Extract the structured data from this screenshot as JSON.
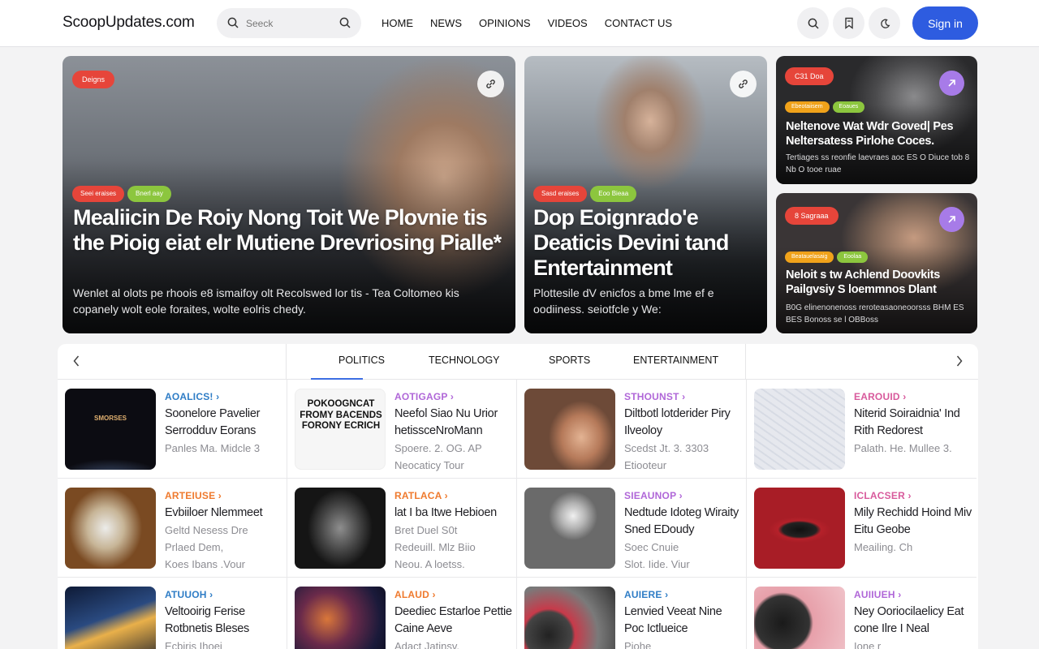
{
  "header": {
    "logo": "ScoopUpdates.com",
    "search_placeholder": "Seeck",
    "nav": [
      "HOME",
      "NEWS",
      "OPINIONS",
      "VIDEOS",
      "CONTACT US"
    ],
    "signin": "Sign in",
    "icons": [
      "search-icon",
      "bookmark-icon",
      "moon-icon"
    ],
    "accent": "#2e5ce0"
  },
  "hero": {
    "main": {
      "badge": "Deigns",
      "tags": [
        "Seei eraises",
        "Bnerl aay"
      ],
      "title": "Mealiicin De Roiy Nong Toit We Plovnie tis the Pioig eiat elr Mutiene Drevriosing Pialle*",
      "desc": "Wenlet al olots pe rhoois e8 ismaifoy olt Recolswed lor tis - Tea Coltomeo kis copanely wolt eole foraites, wolte eolris chedy."
    },
    "second": {
      "tags": [
        "Sasd eraises",
        "Eoo Bieaa"
      ],
      "title": "Dop Eoignrado'e Deaticis Devini tand Entertainment",
      "desc": "Plottesile dV enicfos a bme lme ef e oodiiness. seiotfcle y We:"
    },
    "side1": {
      "badge": "C31 Doa",
      "tags": [
        "Ebeotaiisem",
        "Eoaues"
      ],
      "title": "Neltenove Wat Wdr Goved| Pes Neltersatess Pirlohe Coces.",
      "desc": "Tertiages ss reonfie laevraes aoc ES O Diuce tob 8 Nb O tooe ruae"
    },
    "side2": {
      "badge": "8 Sagraaa",
      "tags": [
        "Beatauelasaig",
        "Eoolaa"
      ],
      "title": "Neloit s tw Achlend Doovkits Pailgvsiy S loemmnos Dlant",
      "desc": "B0G elinenonenoss reroteasaoneoorsss BHM ES BES Bonoss se l OBBoss"
    }
  },
  "tabs": [
    "POLITICS",
    "TECHNOLOGY",
    "SPORTS",
    "ENTERTAINMENT"
  ],
  "articles": [
    {
      "cat": "AOALICS! ›",
      "title": "Soonelore Pavelier Serrodduv Eorans",
      "meta": [
        "Panles Ma. Midcle 3"
      ],
      "color": "blue",
      "thumb_text": "SMORSES"
    },
    {
      "cat": "AOTIGAGP ›",
      "title": "Neefol Siao Nu Urior hetissceNroMann",
      "meta": [
        "Spoere. 2. OG. AP",
        "Neocaticy Tour"
      ],
      "color": "purple",
      "thumb_text": "POKOOGNCAT FROMY BACENDS FORONY ECRICH"
    },
    {
      "cat": "STHOUNST ›",
      "title": "Diltbotl lotderider Piry Ilveoloy",
      "meta": [
        "Scedst Jt. 3. 3303",
        "Etiooteur"
      ],
      "color": "purple"
    },
    {
      "cat": "EAROUID ›",
      "title": "Niterid Soiraidnia' Ind Rith Redorest",
      "meta": [
        "Palath. He. Mullee 3."
      ],
      "color": "pink"
    },
    {
      "cat": "ARTEIUSE ›",
      "title": "Evbiiloer Nlemmeet",
      "meta": [
        "Geltd Nesess Dre",
        "Prlaed Dem,",
        "Koes Ibans .Vour"
      ],
      "color": "orange"
    },
    {
      "cat": "RATLACA ›",
      "title": "lat I ba Itwe Hebioen",
      "meta": [
        "Bret Duel S0t",
        "Redeuill. Mlz Biio",
        "Neou. A loetss."
      ],
      "color": "orange"
    },
    {
      "cat": "SIEAUNOP ›",
      "title": "Nedtude Idoteg Wiraity Sned EDoudy",
      "meta": [
        "Soec Cnuie",
        "Slot. Iide. Viur"
      ],
      "color": "purple"
    },
    {
      "cat": "ICLACSER ›",
      "title": "Mily Rechidd Hoind Miv Eitu Geobe",
      "meta": [
        "Meailing. Ch"
      ],
      "color": "pink"
    },
    {
      "cat": "ATUUOH ›",
      "title": "Veltooirig Ferise Rotbnetis Bleses",
      "meta": [
        "Ecbiris Ihoei"
      ],
      "color": "blue"
    },
    {
      "cat": "ALAUD ›",
      "title": "Deediec Estarloe Pettie Caine Aeve",
      "meta": [
        "Adact Jatinsv."
      ],
      "color": "orange"
    },
    {
      "cat": "AUIERE ›",
      "title": "Lenvied Veeat Nine Poc Ictlueice",
      "meta": [
        "Piohe"
      ],
      "color": "blue"
    },
    {
      "cat": "AUIIUEH ›",
      "title": "Ney Ooriocilaelicy Eat cone Ilre I Neal",
      "meta": [
        "Ione r"
      ],
      "color": "purple"
    }
  ]
}
